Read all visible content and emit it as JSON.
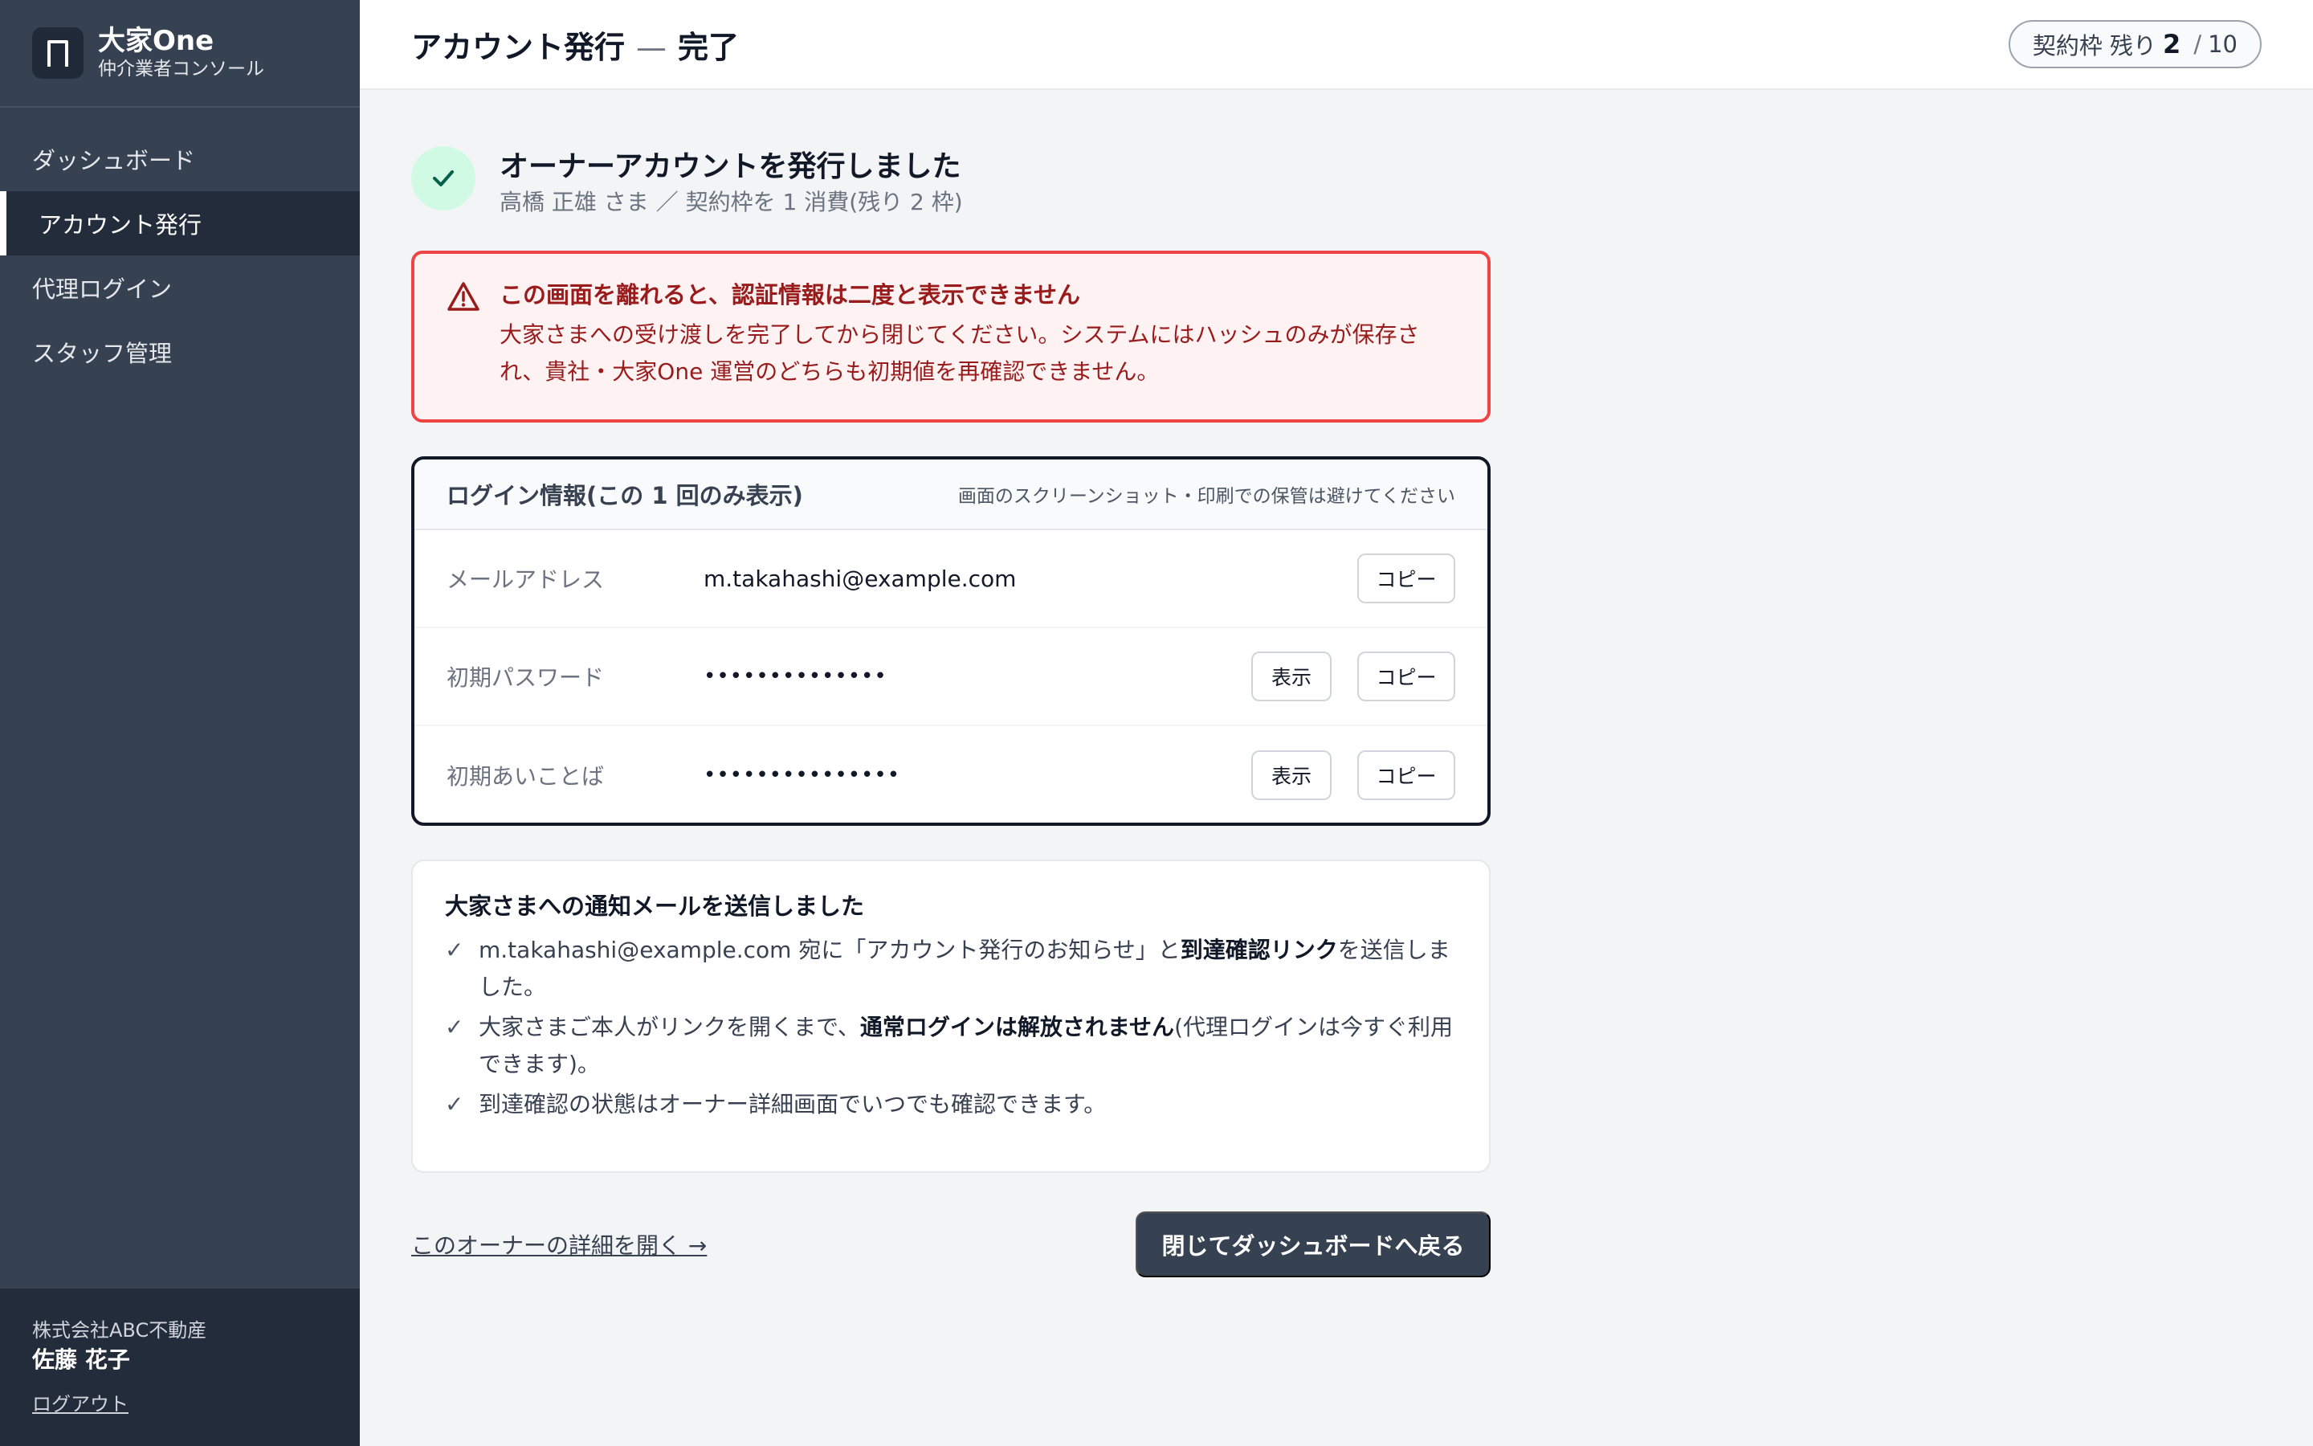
{
  "brand": {
    "name": "大家One",
    "subtitle": "仲介業者コンソール"
  },
  "nav": {
    "items": [
      {
        "label": "ダッシュボード",
        "active": false
      },
      {
        "label": "アカウント発行",
        "active": true
      },
      {
        "label": "代理ログイン",
        "active": false
      },
      {
        "label": "スタッフ管理",
        "active": false
      }
    ]
  },
  "user": {
    "company": "株式会社ABC不動産",
    "name": "佐藤 花子",
    "logout_label": "ログアウト"
  },
  "header": {
    "title": "アカウント発行",
    "separator": "—",
    "title_suffix": "完了",
    "quota_label": "契約枠 残り",
    "quota_remaining": "2",
    "quota_slash": "/",
    "quota_total": "10"
  },
  "success": {
    "title": "オーナーアカウントを発行しました",
    "subtitle": "高橋 正雄 さま ／ 契約枠を 1 消費(残り 2 枠)"
  },
  "alert": {
    "title": "この画面を離れると、認証情報は二度と表示できません",
    "body": "大家さまへの受け渡しを完了してから閉じてください。システムにはハッシュのみが保存され、貴社・大家One 運営のどちらも初期値を再確認できません。"
  },
  "login": {
    "title": "ログイン情報(この 1 回のみ表示)",
    "note": "画面のスクリーンショット・印刷での保管は避けてください",
    "show_label": "表示",
    "copy_label": "コピー",
    "rows": [
      {
        "label": "メールアドレス",
        "value": "m.takahashi@example.com"
      },
      {
        "label": "初期パスワード",
        "value": "••••••••••••••"
      },
      {
        "label": "初期あいことば",
        "value": "•••••••••••••••"
      }
    ]
  },
  "notice": {
    "title": "大家さまへの通知メールを送信しました",
    "items": [
      {
        "pre": "m.takahashi@example.com 宛に「アカウント発行のお知らせ」と",
        "bold": "到達確認リンク",
        "post": "を送信しました。"
      },
      {
        "pre": "大家さまご本人がリンクを開くまで、",
        "bold": "通常ログインは解放されません",
        "post": "(代理ログインは今すぐ利用できます)。"
      },
      {
        "pre": "到達確認の状態はオーナー詳細画面でいつでも確認できます。",
        "bold": "",
        "post": ""
      }
    ]
  },
  "actions": {
    "detail_link": "このオーナーの詳細を開く →",
    "close_button": "閉じてダッシュボードへ戻る"
  }
}
